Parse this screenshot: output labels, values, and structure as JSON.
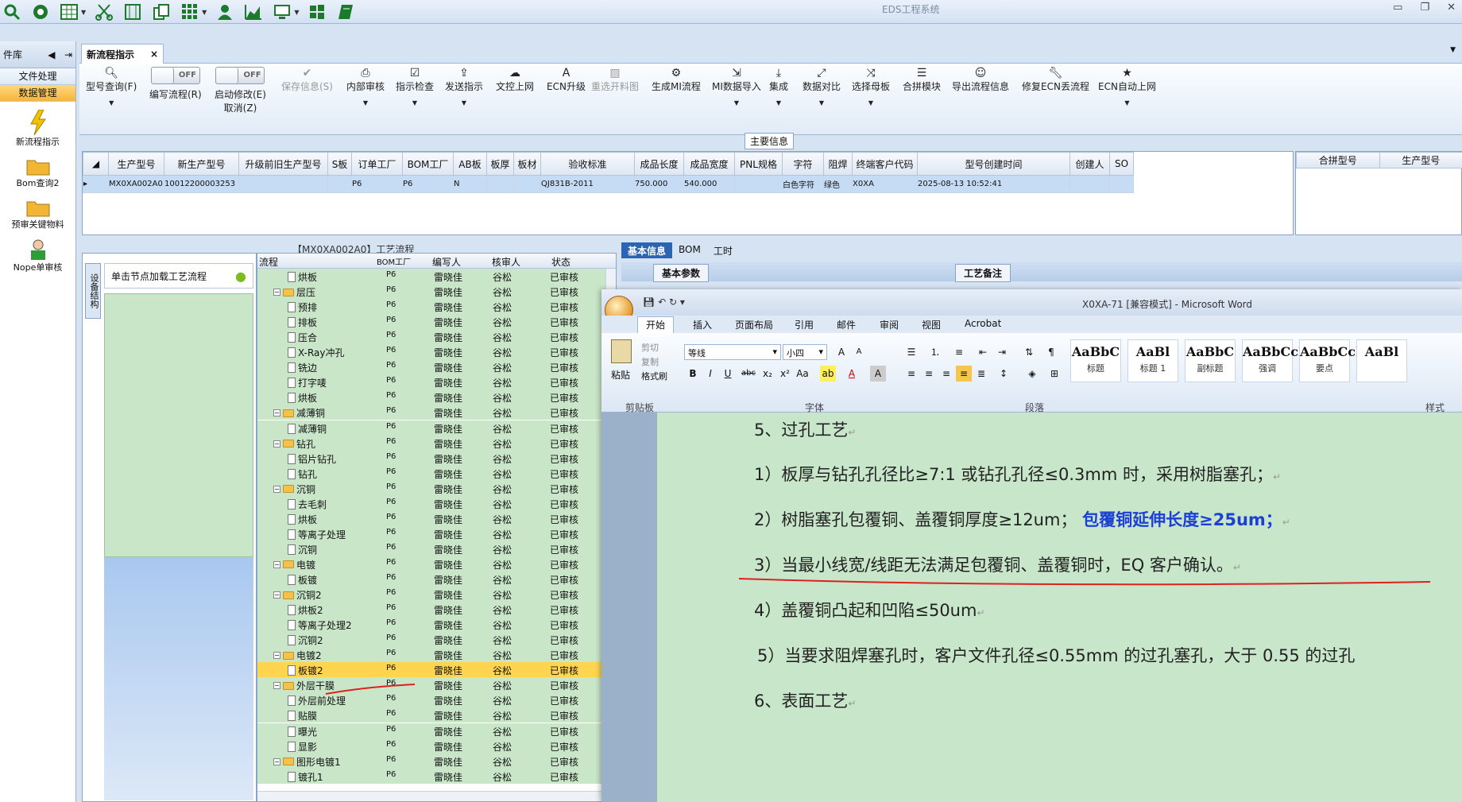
{
  "app": {
    "title": "EDS工程系统"
  },
  "left_panel": {
    "header": "件库",
    "items": [
      "文件处理",
      "数据管理"
    ],
    "tiles": [
      "新流程指示",
      "Bom查询2",
      "预审关键物料",
      "Nope单审核"
    ]
  },
  "tab": {
    "label": "新流程指示",
    "close": "×"
  },
  "toolbar": {
    "buttons": [
      {
        "label": "型号查询(F)"
      },
      {
        "label": "编写流程(R)",
        "toggle": "OFF"
      },
      {
        "label": "启动修改(E)",
        "label2": "取消(Z)",
        "toggle": "OFF"
      },
      {
        "label": "保存信息(S)"
      },
      {
        "label": "内部审核"
      },
      {
        "label": "指示检查"
      },
      {
        "label": "发送指示"
      },
      {
        "label": "文控上网"
      },
      {
        "label": "ECN升级"
      },
      {
        "label": "重选开料图"
      },
      {
        "label": "生成MI流程"
      },
      {
        "label": "MI数据导入"
      },
      {
        "label": "集成"
      },
      {
        "label": "数据对比"
      },
      {
        "label": "选择母板"
      },
      {
        "label": "合拼模块"
      },
      {
        "label": "导出流程信息"
      },
      {
        "label": "修复ECN丢流程"
      },
      {
        "label": "ECN自动上网"
      }
    ]
  },
  "main_info": {
    "label": "主要信息",
    "columns": [
      "生产型号",
      "新生产型号",
      "升级前旧生产型号",
      "S板",
      "订单工厂",
      "BOM工厂",
      "AB板",
      "板厚",
      "板材",
      "验收标准",
      "成品长度",
      "成品宽度",
      "PNL规格",
      "字符",
      "阻焊",
      "终端客户代码",
      "型号创建时间",
      "创建人",
      "SO"
    ],
    "row": [
      "MX0XA002A0",
      "10012200003253",
      "",
      "",
      "P6",
      "P6",
      "N",
      "",
      "",
      "QJ831B-2011",
      "750.000",
      "540.000",
      "",
      "白色字符",
      "绿色",
      "X0XA",
      "2025-08-13 10:52:41",
      "",
      ""
    ]
  },
  "side_grid": {
    "columns": [
      "合拼型号",
      "生产型号"
    ]
  },
  "flow": {
    "title": "【MX0XA002A0】工艺流程",
    "vtab": "设备结构",
    "load_label": "单击节点加载工艺流程",
    "columns": [
      "流程",
      "BOM工厂",
      "编写人",
      "核审人",
      "状态"
    ],
    "rows": [
      {
        "name": "烘板",
        "level": 2
      },
      {
        "name": "层压",
        "level": 1
      },
      {
        "name": "预排",
        "level": 2
      },
      {
        "name": "排板",
        "level": 2
      },
      {
        "name": "压合",
        "level": 2
      },
      {
        "name": "X-Ray冲孔",
        "level": 2
      },
      {
        "name": "铣边",
        "level": 2
      },
      {
        "name": "打字唛",
        "level": 2
      },
      {
        "name": "烘板",
        "level": 2
      },
      {
        "name": "减薄铜",
        "level": 1
      },
      {
        "name": "减薄铜",
        "level": 2
      },
      {
        "name": "钻孔",
        "level": 1
      },
      {
        "name": "铝片钻孔",
        "level": 2
      },
      {
        "name": "钻孔",
        "level": 2
      },
      {
        "name": "沉铜",
        "level": 1
      },
      {
        "name": "去毛刺",
        "level": 2
      },
      {
        "name": "烘板",
        "level": 2
      },
      {
        "name": "等离子处理",
        "level": 2
      },
      {
        "name": "沉铜",
        "level": 2
      },
      {
        "name": "电镀",
        "level": 1
      },
      {
        "name": "板镀",
        "level": 2
      },
      {
        "name": "沉铜2",
        "level": 1
      },
      {
        "name": "烘板2",
        "level": 2
      },
      {
        "name": "等离子处理2",
        "level": 2
      },
      {
        "name": "沉铜2",
        "level": 2
      },
      {
        "name": "电镀2",
        "level": 1
      },
      {
        "name": "板镀2",
        "level": 2,
        "selected": true
      },
      {
        "name": "外层干膜",
        "level": 1
      },
      {
        "name": "外层前处理",
        "level": 2
      },
      {
        "name": "贴膜",
        "level": 2
      },
      {
        "name": "曝光",
        "level": 2
      },
      {
        "name": "显影",
        "level": 2
      },
      {
        "name": "图形电镀1",
        "level": 1
      },
      {
        "name": "镀孔1",
        "level": 2
      }
    ],
    "factory": "P6",
    "writer": "雷晓佳",
    "reviewer": "谷松",
    "status": "已审核"
  },
  "right_tabs": [
    "基本信息",
    "BOM",
    "工时"
  ],
  "params_buttons": [
    "基本参数",
    "工艺备注"
  ],
  "word": {
    "title": "X0XA-71 [兼容模式] - Microsoft Word",
    "tabs": [
      "开始",
      "插入",
      "页面布局",
      "引用",
      "邮件",
      "审阅",
      "视图",
      "Acrobat"
    ],
    "clipboard": {
      "paste": "粘贴",
      "cut": "剪切",
      "copy": "复制",
      "painter": "格式刷",
      "label": "剪贴板"
    },
    "font": {
      "name": "等线",
      "size": "小四",
      "label": "字体"
    },
    "paragraph_label": "段落",
    "styles_label": "样式",
    "styles": [
      {
        "sample": "AaBbC",
        "name": "标题"
      },
      {
        "sample": "AaBl",
        "name": "标题 1"
      },
      {
        "sample": "AaBbC",
        "name": "副标题"
      },
      {
        "sample": "AaBbCcD",
        "name": "强调"
      },
      {
        "sample": "AaBbCcD",
        "name": "要点"
      },
      {
        "sample": "AaBl",
        "name": ""
      }
    ],
    "paragraphs": [
      "5、过孔工艺",
      "1）板厚与钻孔孔径比≥7:1 或钻孔孔径≤0.3mm 时，采用树脂塞孔；",
      "2）树脂塞孔包覆铜、盖覆铜厚度≥12um；",
      "3）当最小线宽/线距无法满足包覆铜、盖覆铜时，EQ 客户确认。",
      "4）盖覆铜凸起和凹陷≤50um",
      "5）当要求阻焊塞孔时，客户文件孔径≤0.55mm 的过孔塞孔，大于 0.55 的过孔",
      "6、表面工艺"
    ],
    "highlight": "包覆铜延伸长度≥25um；"
  }
}
